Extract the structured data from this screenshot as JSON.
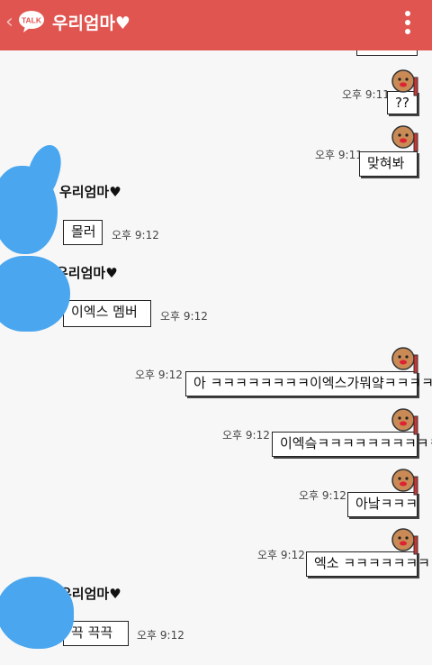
{
  "header": {
    "logo_text": "TALK",
    "title": "우리엄마♥",
    "back_glyph": "‹"
  },
  "contact_name": "우리엄마♥",
  "messages": [
    {
      "text": "??",
      "time": "오후 9:11"
    },
    {
      "text": "맞혀봐",
      "time": "오후 9:11"
    },
    {
      "text": "몰러",
      "time": "오후 9:12"
    },
    {
      "text": "이엑스  멤버",
      "time": "오후 9:12"
    },
    {
      "text": "아 ㅋㅋㅋㅋㅋㅋㅋㅋ이엑스가뭐얔ㅋㅋㅋㅋ",
      "time": "오후 9:12"
    },
    {
      "text": "이엑슼ㅋㅋㅋㅋㅋㅋㅋㅋㅋㅋ",
      "time": "오후 9:12"
    },
    {
      "text": "아낰ㅋㅋㅋ",
      "time": "오후 9:12"
    },
    {
      "text": "엑소 ㅋㅋㅋㅋㅋㅋㅋ",
      "time": "오후 9:12"
    },
    {
      "text": "끅 끅끅",
      "time": "오후 9:12"
    }
  ],
  "colors": {
    "header_bg": "#e05550",
    "background": "#f7f7f7",
    "redaction_blue": "#4aa6ee"
  }
}
